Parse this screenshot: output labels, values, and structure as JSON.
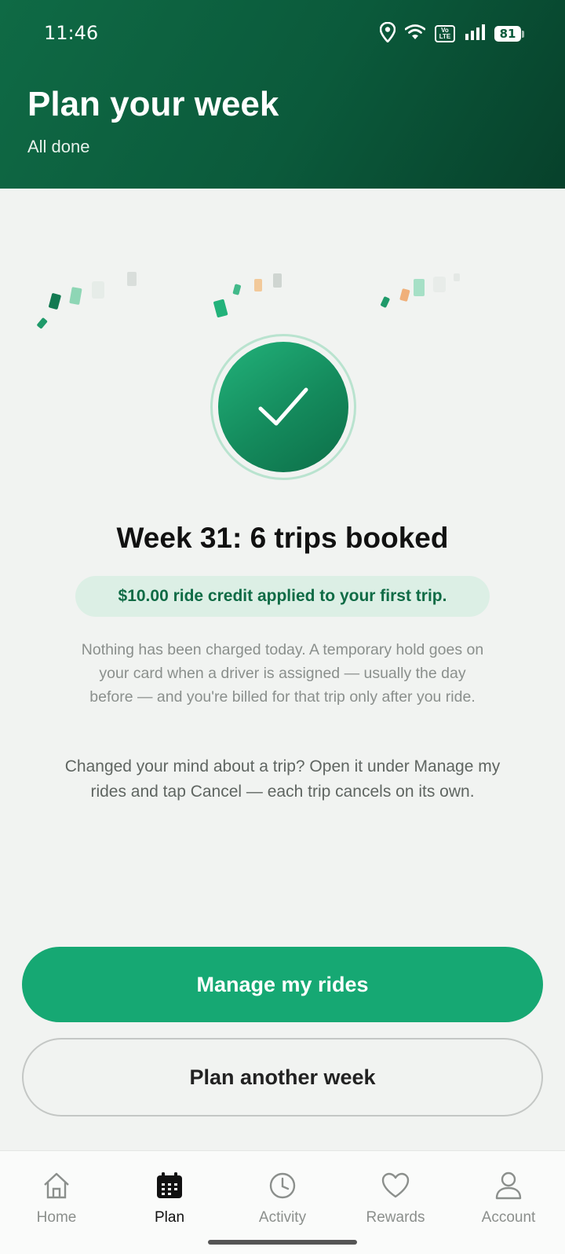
{
  "status_bar": {
    "time": "11:46",
    "battery": "81",
    "volte_top": "Vo",
    "volte_bottom": "LTE"
  },
  "header": {
    "title": "Plan your week",
    "subtitle": "All done"
  },
  "confirmation": {
    "headline": "Week 31: 6 trips booked",
    "credit_note": "$10.00 ride credit applied to your first trip.",
    "billing_info": "Nothing has been charged today. A temporary hold goes on your card when a driver is assigned — usually the day before — and you're billed for that trip only after you ride.",
    "cancel_info": "Changed your mind about a trip? Open it under Manage my rides and tap Cancel — each trip cancels on its own."
  },
  "actions": {
    "primary_label": "Manage my rides",
    "secondary_label": "Plan another week"
  },
  "bottom_nav": {
    "items": [
      {
        "label": "Home",
        "icon": "home-icon",
        "active": false
      },
      {
        "label": "Plan",
        "icon": "calendar-icon",
        "active": true
      },
      {
        "label": "Activity",
        "icon": "clock-icon",
        "active": false
      },
      {
        "label": "Rewards",
        "icon": "heart-icon",
        "active": false
      },
      {
        "label": "Account",
        "icon": "person-icon",
        "active": false
      }
    ]
  },
  "colors": {
    "header_bg": "#0b5a3b",
    "accent": "#16a873",
    "credit_pill_bg": "#dcefe5",
    "credit_text": "#0f6b45"
  }
}
